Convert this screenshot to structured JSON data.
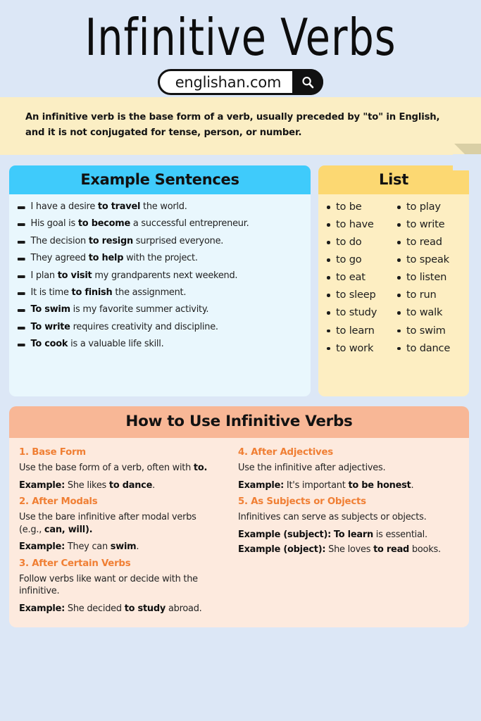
{
  "header": {
    "title": "Infinitive Verbs",
    "search": {
      "domain": "englishan.com",
      "icon": "search-icon"
    }
  },
  "intro": {
    "text": "An infinitive verb is the base form of a verb, usually preceded by \"to\" in English, and it is not conjugated for tense, person, or number."
  },
  "examples_card": {
    "title": "Example Sentences",
    "header_color": "#3fcbfb",
    "body_color": "#e9f7fd",
    "items": [
      {
        "pre": "I have a desire ",
        "bold": "to travel",
        "post": " the world."
      },
      {
        "pre": "His goal is ",
        "bold": "to become",
        "post": " a successful entrepreneur."
      },
      {
        "pre": "The decision ",
        "bold": "to resign",
        "post": " surprised everyone."
      },
      {
        "pre": "They agreed ",
        "bold": "to help",
        "post": " with the project."
      },
      {
        "pre": "I plan ",
        "bold": "to visit",
        "post": " my grandparents next weekend."
      },
      {
        "pre": "It is time ",
        "bold": "to finish",
        "post": " the assignment."
      },
      {
        "pre": "",
        "bold": "To swim",
        "post": " is my favorite summer activity."
      },
      {
        "pre": "",
        "bold": "To write",
        "post": " requires creativity and discipline."
      },
      {
        "pre": "",
        "bold": "To cook",
        "post": " is a valuable life skill."
      }
    ]
  },
  "list_card": {
    "title": "List",
    "header_color": "#fcd872",
    "body_color": "#fdeec2",
    "column_left": [
      "to be",
      "to have",
      "to do",
      "to go",
      "to eat",
      "to sleep",
      "to study",
      "to learn",
      "to work"
    ],
    "column_right": [
      "to play",
      "to write",
      "to read",
      "to speak",
      "to listen",
      "to run",
      "to walk",
      "to swim",
      "to dance"
    ]
  },
  "howto": {
    "title": "How to Use Infinitive Verbs",
    "header_color": "#f8b796",
    "body_color": "#fdeade",
    "accent_color": "#f07f34",
    "left_rules": [
      {
        "heading": "1. Base Form",
        "text_pre": "Use the base form of a verb, often with ",
        "text_bold": "to.",
        "text_post": "",
        "example_label": "Example:",
        "example_pre": " She likes ",
        "example_bold": "to dance",
        "example_post": "."
      },
      {
        "heading": "2. After Modals",
        "text_pre": "Use the bare infinitive after modal verbs (e.g., ",
        "text_bold": "can, will).",
        "text_post": "",
        "example_label": "Example:",
        "example_pre": " They can ",
        "example_bold": "swim",
        "example_post": "."
      },
      {
        "heading": "3. After Certain Verbs",
        "text_pre": "Follow verbs like want or decide with the infinitive.",
        "text_bold": "",
        "text_post": "",
        "example_label": "Example:",
        "example_pre": " She decided ",
        "example_bold": "to study",
        "example_post": " abroad."
      }
    ],
    "right_rules": [
      {
        "heading": "4. After Adjectives",
        "text_pre": "Use the infinitive after adjectives.",
        "text_bold": "",
        "text_post": "",
        "example_label": "Example:",
        "example_pre": " It's important ",
        "example_bold": "to be honest",
        "example_post": "."
      },
      {
        "heading": "5. As Subjects or Objects",
        "text_pre": "Infinitives can serve as subjects or objects.",
        "text_bold": "",
        "text_post": "",
        "example_label": "Example (subject):",
        "example_pre": " ",
        "example_bold": "To learn",
        "example_post": " is essential.",
        "example2_label": "Example (object):",
        "example2_pre": " She loves ",
        "example2_bold": "to read",
        "example2_post": " books."
      }
    ]
  }
}
